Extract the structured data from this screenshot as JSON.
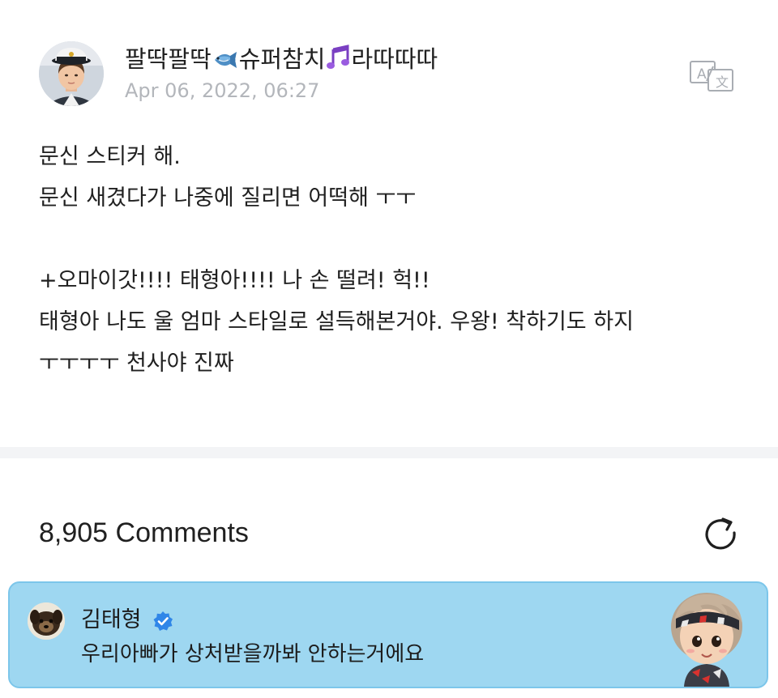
{
  "post": {
    "author": {
      "name_part1": "팔딱팔딱",
      "emoji1": "fish-emoji",
      "name_part2": "슈퍼참치",
      "emoji2": "musical-notes-emoji",
      "name_part3": "라따따따"
    },
    "timestamp": "Apr 06, 2022, 06:27",
    "translate_icon": "translate-icon",
    "body_lines": [
      "문신 스티커 해.",
      "문신 새겼다가 나중에 질리면 어떡해 ㅜㅜ",
      "",
      "+오마이갓!!!! 태형아!!!! 나 손 떨려! 헉!!",
      "태형아 나도 울 엄마 스타일로 설득해본거야. 우왕! 착하기도 하지",
      "ㅜㅜㅜㅜ 천사야 진짜"
    ]
  },
  "comments": {
    "count_label": "8,905 Comments",
    "refresh_icon": "refresh-icon",
    "featured": {
      "author": "김태형",
      "verified_icon": "verified-badge-icon",
      "text": "우리아빠가 상처받을까봐 안하는거에요",
      "background_color": "#9ed7f1",
      "sticker": "character-sticker"
    }
  },
  "colors": {
    "timestamp": "#b3b6bb",
    "verified_blue": "#2f86e8",
    "divider": "#f3f4f6"
  }
}
